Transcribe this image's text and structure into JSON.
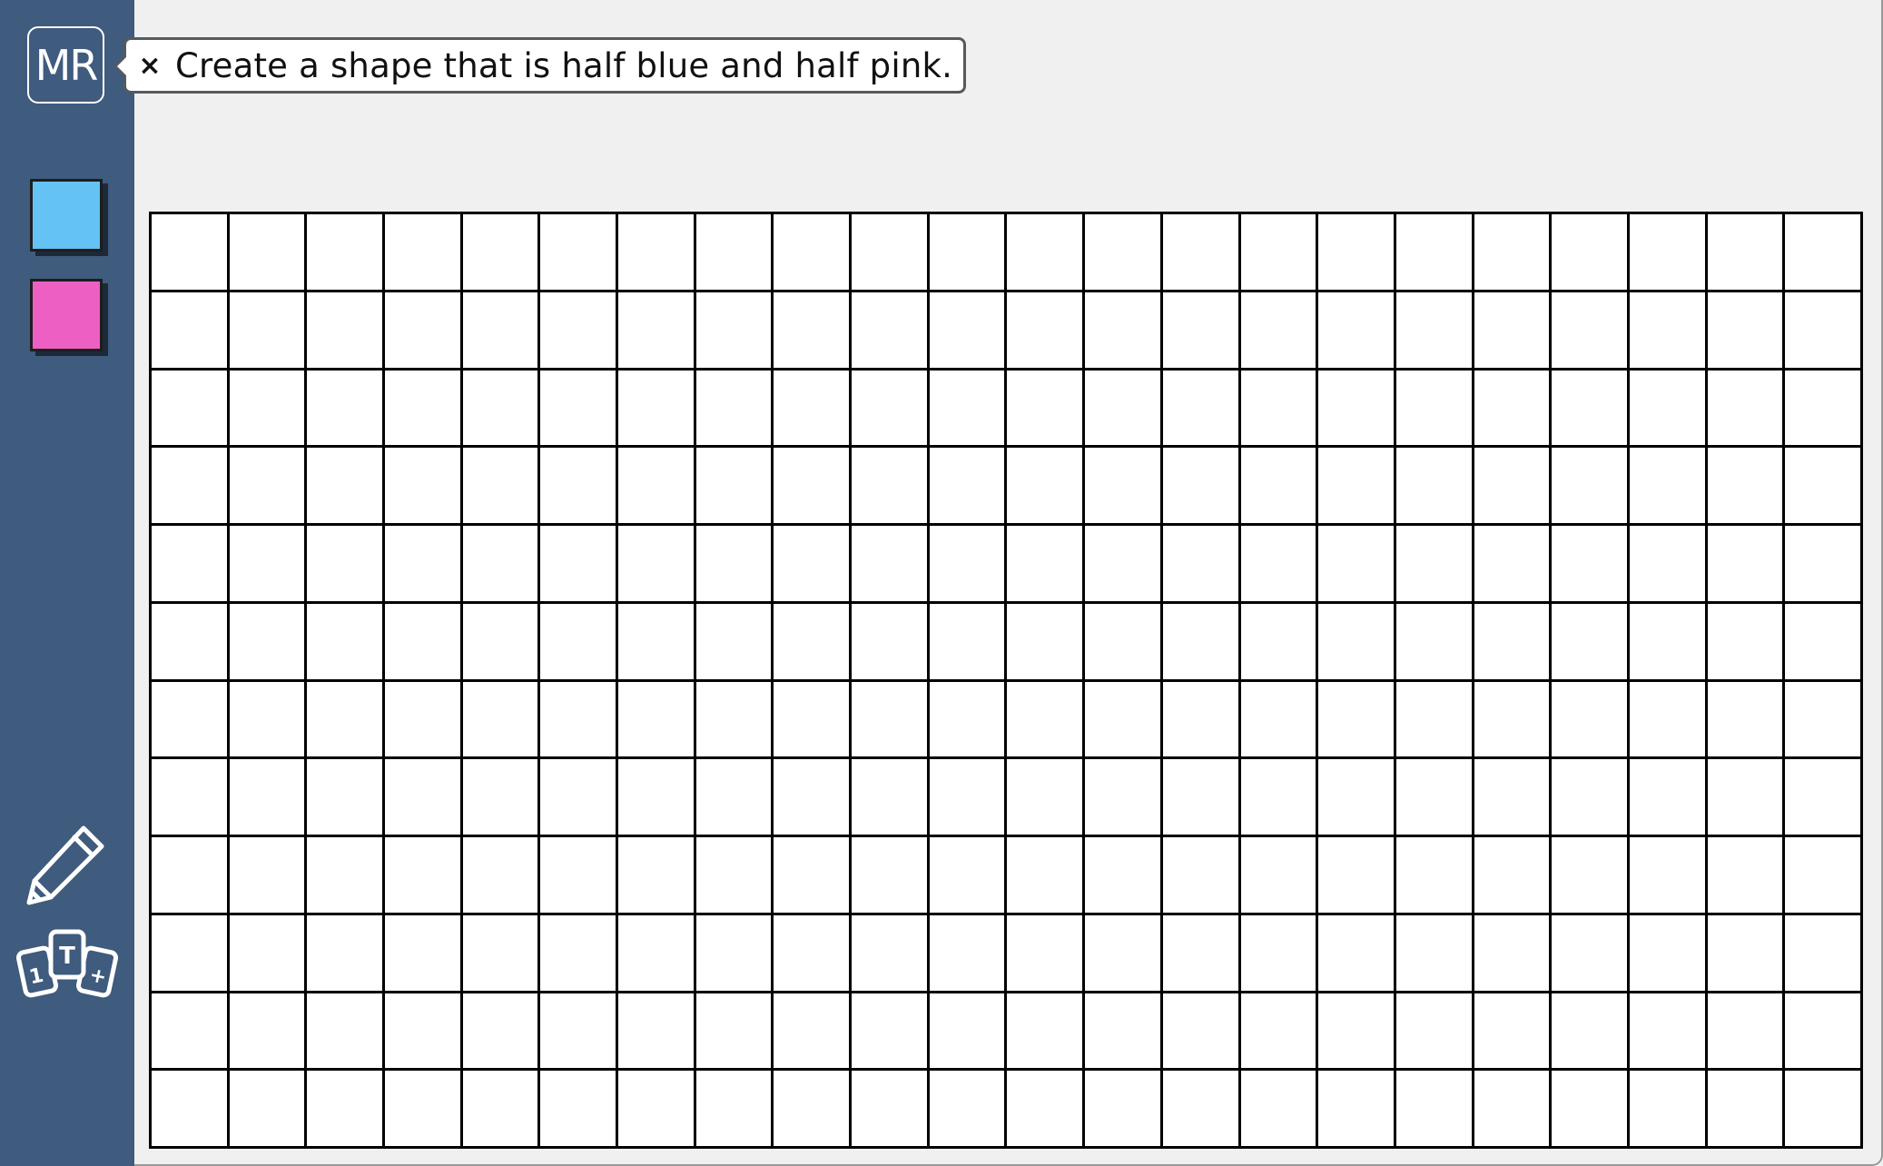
{
  "user": {
    "initials": "MR"
  },
  "palette": [
    {
      "name": "blue",
      "color": "#64c2f5"
    },
    {
      "name": "pink",
      "color": "#ee5fc4"
    }
  ],
  "tools": {
    "pencil_icon": "pencil-icon",
    "cards_icon": "number-cards-icon",
    "cards_labels": [
      "1",
      "T",
      "+"
    ]
  },
  "prompt": {
    "close_label": "×",
    "text": "Create a shape that is half blue and half pink."
  },
  "grid": {
    "columns": 22,
    "rows": 12,
    "cell_color": "#ffffff",
    "line_color": "#000000"
  }
}
